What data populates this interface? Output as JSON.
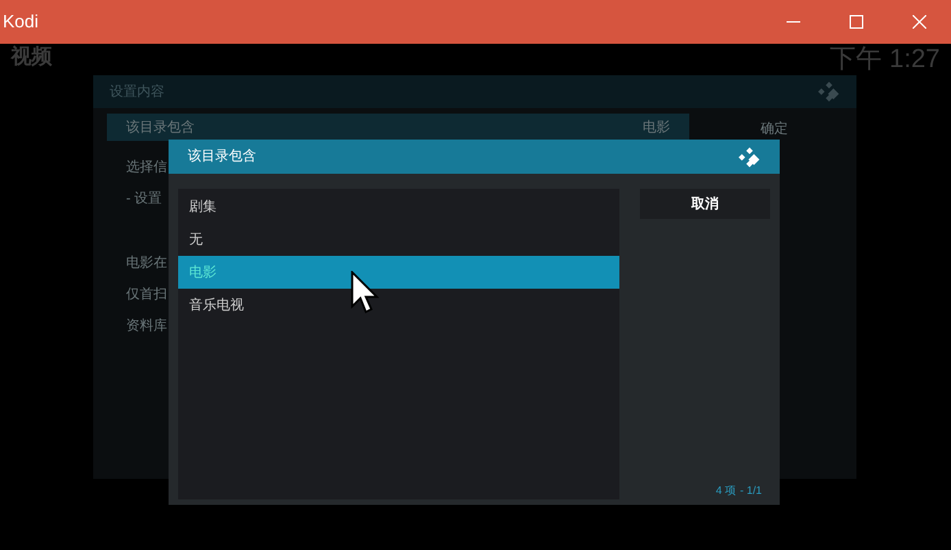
{
  "window": {
    "title": "Kodi"
  },
  "background": {
    "section_title": "视频",
    "clock": "下午 1:27",
    "panel_title": "设置内容",
    "rows": [
      {
        "label": "该目录包含",
        "value": "电影",
        "selected": true
      },
      {
        "label": "选择信",
        "selected": false
      },
      {
        "label": "- 设置",
        "selected": false
      },
      {
        "label": "电影在",
        "selected": false
      },
      {
        "label": "仅首扫",
        "selected": false
      },
      {
        "label": "资料库",
        "selected": false
      }
    ],
    "buttons": [
      "确定"
    ]
  },
  "dialog": {
    "title": "该目录包含",
    "items": [
      {
        "label": "剧集",
        "selected": false
      },
      {
        "label": "无",
        "selected": false
      },
      {
        "label": "电影",
        "selected": true
      },
      {
        "label": "音乐电视",
        "selected": false
      }
    ],
    "buttons": [
      "取消"
    ],
    "count": "4 项",
    "page": "- 1/1"
  }
}
